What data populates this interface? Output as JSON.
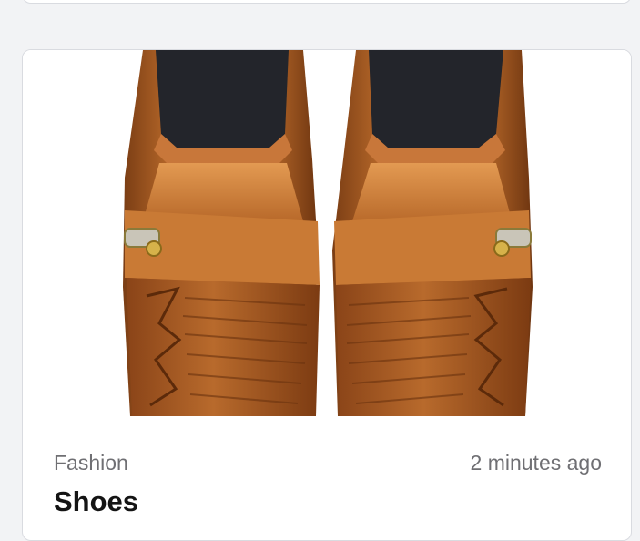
{
  "post": {
    "category": "Fashion",
    "timestamp": "2 minutes ago",
    "title": "Shoes",
    "image_icon": "brown-leather-loafers-image"
  },
  "colors": {
    "page_bg": "#f2f3f5",
    "card_bg": "#ffffff",
    "card_border": "#d9dbe0",
    "leather": "#b8692a",
    "leather_dark": "#7a3d14",
    "insole": "#23252b",
    "meta_text": "#6f6f73",
    "title_text": "#141414"
  }
}
